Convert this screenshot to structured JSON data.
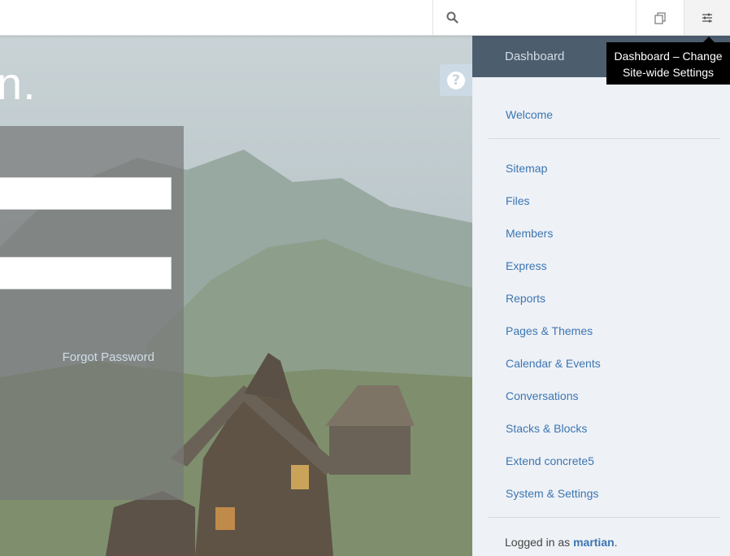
{
  "toolbar": {
    "search_placeholder": "",
    "search_icon": "search-icon",
    "sitemap_icon": "sitemap-icon",
    "settings_icon": "sliders-icon"
  },
  "login": {
    "headline": "n.",
    "forgot_password": "Forgot Password",
    "help_icon": "question-icon"
  },
  "dashboard": {
    "title": "Dashboard",
    "welcome": "Welcome",
    "items": [
      "Sitemap",
      "Files",
      "Members",
      "Express",
      "Reports",
      "Pages & Themes",
      "Calendar & Events",
      "Conversations",
      "Stacks & Blocks",
      "Extend concrete5",
      "System & Settings"
    ],
    "logged_in_prefix": "Logged in as ",
    "user": "martian",
    "logged_in_suffix": "."
  },
  "tooltip": {
    "line1": "Dashboard – Change",
    "line2": "Site-wide Settings"
  },
  "colors": {
    "accent_link": "#3c76b3",
    "dash_header": "#4c5d6e",
    "dash_bg": "#eef1f6",
    "tooltip_bg": "#000000"
  }
}
